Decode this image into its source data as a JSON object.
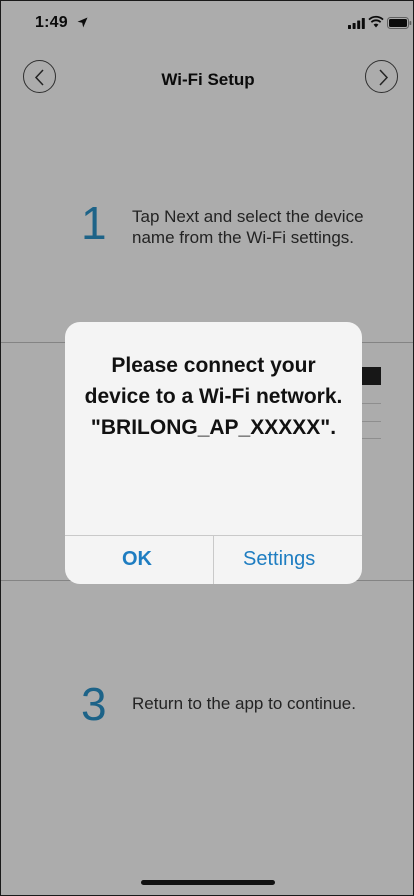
{
  "status_bar": {
    "time": "1:49",
    "icons": [
      "location-arrow-icon",
      "cellular-signal-icon",
      "wifi-icon",
      "battery-icon"
    ]
  },
  "nav": {
    "title": "Wi-Fi Setup",
    "back_icon": "chevron-left-icon",
    "forward_icon": "chevron-right-icon"
  },
  "steps": [
    {
      "number": "1",
      "text": "Tap Next and select the device name from the Wi-Fi settings."
    },
    {
      "number": "3",
      "text": "Return to the app to continue."
    }
  ],
  "alert": {
    "message": "Please connect your device to a Wi-Fi network. \"BRILONG_AP_XXXXX\".",
    "ok_label": "OK",
    "settings_label": "Settings"
  },
  "colors": {
    "accent": "#2a8fc3",
    "alert_button": "#1e7dc1",
    "background": "#f7f7f7"
  }
}
